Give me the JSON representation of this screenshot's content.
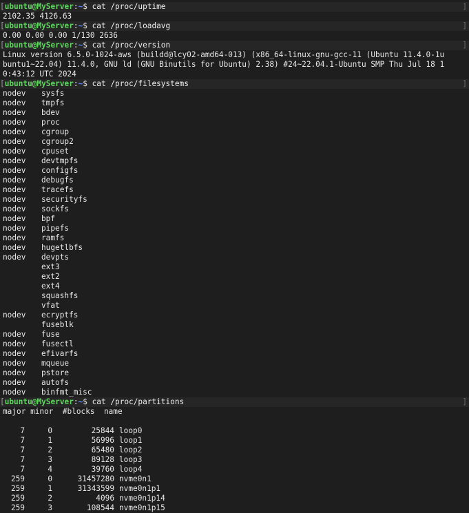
{
  "prompt": {
    "user": "ubuntu",
    "at": "@",
    "host": "MyServer",
    "sep": ":",
    "path": "~",
    "dollar": "$"
  },
  "blocks": [
    {
      "command": "cat /proc/uptime",
      "output": [
        "2102.35 4126.63"
      ]
    },
    {
      "command": "cat /proc/loadavg",
      "output": [
        "0.00 0.00 0.00 1/130 2636"
      ]
    },
    {
      "command": "cat /proc/version",
      "output": [
        "Linux version 6.5.0-1024-aws (buildd@lcy02-amd64-013) (x86_64-linux-gnu-gcc-11 (Ubuntu 11.4.0-1u",
        "buntu1~22.04) 11.4.0, GNU ld (GNU Binutils for Ubuntu) 2.38) #24~22.04.1-Ubuntu SMP Thu Jul 18 1",
        "0:43:12 UTC 2024"
      ]
    }
  ],
  "filesystems": {
    "command": "cat /proc/filesystems",
    "rows": [
      [
        "nodev",
        "sysfs"
      ],
      [
        "nodev",
        "tmpfs"
      ],
      [
        "nodev",
        "bdev"
      ],
      [
        "nodev",
        "proc"
      ],
      [
        "nodev",
        "cgroup"
      ],
      [
        "nodev",
        "cgroup2"
      ],
      [
        "nodev",
        "cpuset"
      ],
      [
        "nodev",
        "devtmpfs"
      ],
      [
        "nodev",
        "configfs"
      ],
      [
        "nodev",
        "debugfs"
      ],
      [
        "nodev",
        "tracefs"
      ],
      [
        "nodev",
        "securityfs"
      ],
      [
        "nodev",
        "sockfs"
      ],
      [
        "nodev",
        "bpf"
      ],
      [
        "nodev",
        "pipefs"
      ],
      [
        "nodev",
        "ramfs"
      ],
      [
        "nodev",
        "hugetlbfs"
      ],
      [
        "nodev",
        "devpts"
      ],
      [
        "",
        "ext3"
      ],
      [
        "",
        "ext2"
      ],
      [
        "",
        "ext4"
      ],
      [
        "",
        "squashfs"
      ],
      [
        "",
        "vfat"
      ],
      [
        "nodev",
        "ecryptfs"
      ],
      [
        "",
        "fuseblk"
      ],
      [
        "nodev",
        "fuse"
      ],
      [
        "nodev",
        "fusectl"
      ],
      [
        "nodev",
        "efivarfs"
      ],
      [
        "nodev",
        "mqueue"
      ],
      [
        "nodev",
        "pstore"
      ],
      [
        "nodev",
        "autofs"
      ],
      [
        "nodev",
        "binfmt_misc"
      ]
    ]
  },
  "partitions": {
    "command": "cat /proc/partitions",
    "header": "major minor  #blocks  name",
    "rows": [
      [
        "7",
        "0",
        "25844",
        "loop0"
      ],
      [
        "7",
        "1",
        "56996",
        "loop1"
      ],
      [
        "7",
        "2",
        "65480",
        "loop2"
      ],
      [
        "7",
        "3",
        "89128",
        "loop3"
      ],
      [
        "7",
        "4",
        "39760",
        "loop4"
      ],
      [
        "259",
        "0",
        "31457280",
        "nvme0n1"
      ],
      [
        "259",
        "1",
        "31343599",
        "nvme0n1p1"
      ],
      [
        "259",
        "2",
        "4096",
        "nvme0n1p14"
      ],
      [
        "259",
        "3",
        "108544",
        "nvme0n1p15"
      ]
    ]
  }
}
